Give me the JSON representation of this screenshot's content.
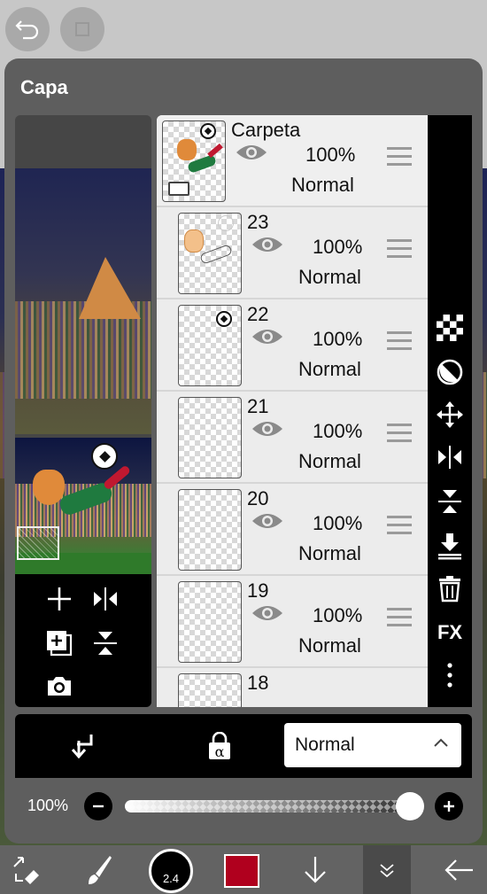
{
  "panel": {
    "title": "Capa"
  },
  "layers": [
    {
      "name": "Carpeta",
      "opacity": "100%",
      "blend": "Normal",
      "type": "folder"
    },
    {
      "name": "23",
      "opacity": "100%",
      "blend": "Normal",
      "type": "layer"
    },
    {
      "name": "22",
      "opacity": "100%",
      "blend": "Normal",
      "type": "layer"
    },
    {
      "name": "21",
      "opacity": "100%",
      "blend": "Normal",
      "type": "layer"
    },
    {
      "name": "20",
      "opacity": "100%",
      "blend": "Normal",
      "type": "layer"
    },
    {
      "name": "19",
      "opacity": "100%",
      "blend": "Normal",
      "type": "layer"
    },
    {
      "name": "18",
      "type": "layer"
    }
  ],
  "right_tools": {
    "fx_label": "FX"
  },
  "blend_bar": {
    "blend_mode": "Normal"
  },
  "opacity_bar": {
    "label": "100%",
    "value": 1.0
  },
  "bottom_bar": {
    "brush_size": "2.4",
    "color": "#b0001e"
  },
  "icons": [
    "undo-icon",
    "redo-icon",
    "plus-icon",
    "flip-horizontal-icon",
    "merge-icon",
    "flip-vertical-icon",
    "camera-icon",
    "eye-icon",
    "drag-handle-icon",
    "checker-icon",
    "half-circle-icon",
    "move-icon",
    "download-icon",
    "trash-icon",
    "more-icon",
    "clip-arrow-icon",
    "alpha-lock-icon",
    "chevron-up-icon",
    "minus-icon"
  ]
}
